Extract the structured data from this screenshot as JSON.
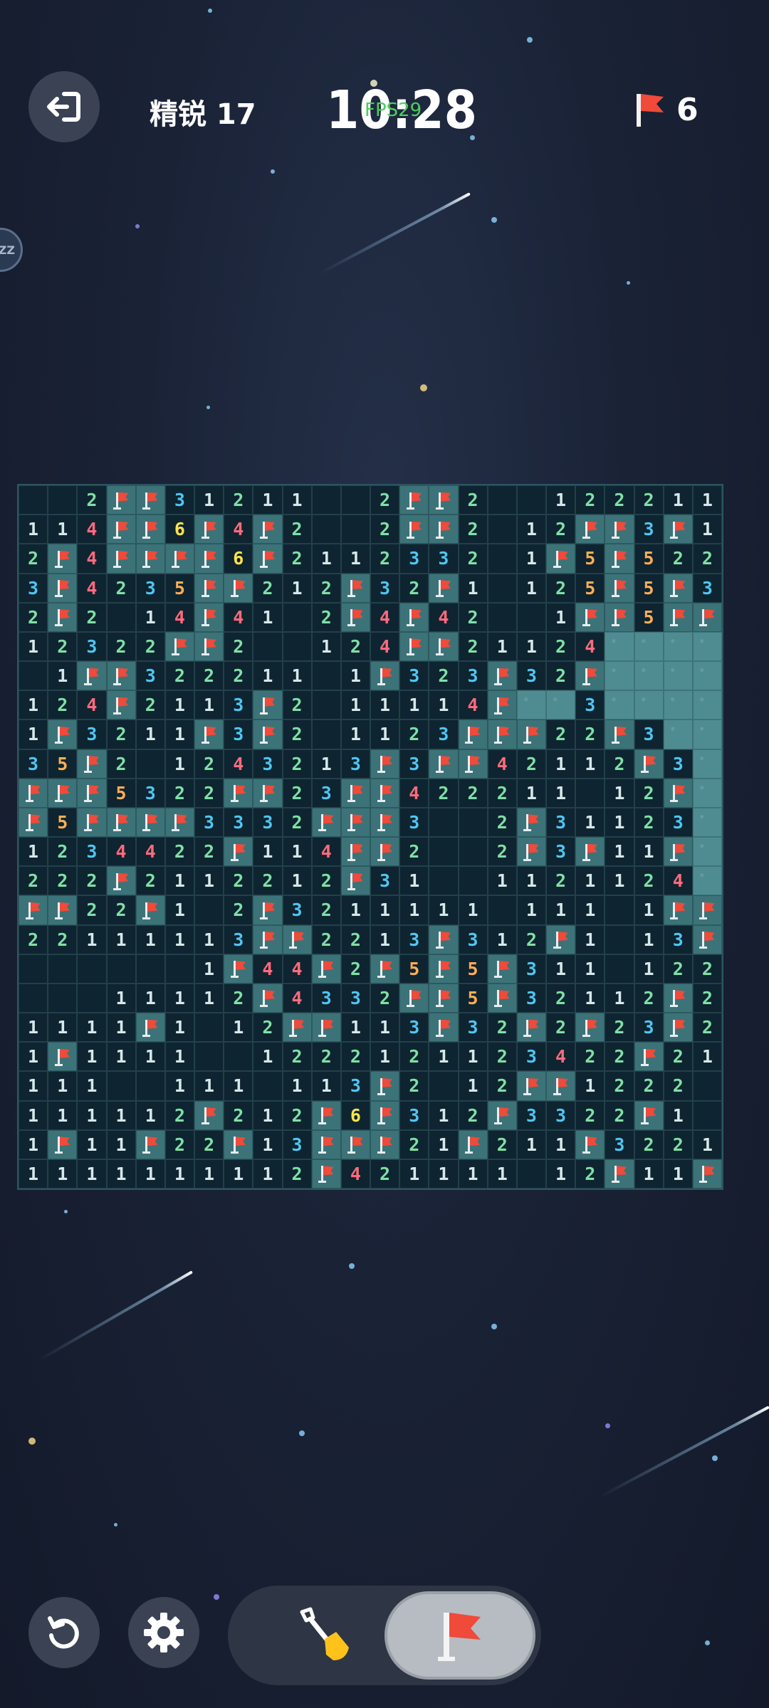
{
  "header": {
    "difficulty_label": "精锐 17",
    "timer": "10:28",
    "fps_overlay": "FPS29",
    "flag_count": "6",
    "side_badge": "ZZ"
  },
  "icons": {
    "exit": "exit-arrow-icon",
    "flag": "red-flag-icon",
    "restart": "restart-icon",
    "settings": "gear-icon",
    "dig": "shovel-icon"
  },
  "colors": {
    "n1": "#d6e8ea",
    "n2": "#7fe0a6",
    "n3": "#4fc6f2",
    "n4": "#ff6a7d",
    "n5": "#ffae55",
    "n6": "#ffe44a",
    "flag": "#ef4a3a",
    "hidden_cell": "#4f8c92",
    "open_cell": "#0e2430"
  },
  "board": {
    "rows": 24,
    "cols": 24,
    "legend": "0=empty revealed, 1-8=number, F=flagged, H=hidden",
    "grid": [
      "0 0 2 F F 3 1 2 1 1 0 0 2 F F 2 0 0 1 2 2 2 1 1",
      "1 1 4 F F 6 F 4 F 2 0 0 2 F F 2 0 1 2 F F 3 F 1",
      "2 F 4 F F F F 6 F 2 1 1 2 3 3 2 0 1 F 5 F 5 2 2",
      "3 F 4 2 3 5 F F 2 1 2 F 3 2 F 1 0 1 2 5 F 5 F 3",
      "2 F 2 0 1 4 F 4 1 0 2 F 4 F 4 2 0 0 1 F F 5 F F",
      "1 2 3 2 2 F F 2 0 0 1 2 4 F F 2 1 1 2 4 H H H H",
      "0 1 F F 3 2 2 2 1 1 0 1 F 3 2 3 F 3 2 F H H H H",
      "1 2 4 F 2 1 1 3 F 2 0 1 1 1 1 4 F H H 3 H H H H",
      "1 F 3 2 1 1 F 3 F 2 0 1 1 2 3 F F F 2 2 F 3 H H",
      "3 5 F 2 0 1 2 4 3 2 1 3 F 3 F F 4 2 1 1 2 F 3 H",
      "F F F 5 3 2 2 F F 2 3 F F 4 2 2 2 1 1 0 1 2 F H",
      "F 5 F F F F 3 3 3 2 F F F 3 0 0 2 F 3 1 1 2 3 H",
      "1 2 3 4 4 2 2 F 1 1 4 F F 2 0 0 2 F 3 F 1 1 F H",
      "2 2 2 F 2 1 1 2 2 1 2 F 3 1 0 0 1 1 2 1 1 2 4 H",
      "F F 2 2 F 1 0 2 F 3 2 1 1 1 1 1 0 1 1 1 0 1 F F",
      "2 2 1 1 1 1 1 3 F F 2 2 1 3 F 3 1 2 F 1 0 1 3 F",
      "0 0 0 0 0 0 1 F 4 4 F 2 F 5 F 5 F 3 1 1 0 1 2 2",
      "0 0 0 1 1 1 1 2 F 4 3 3 2 F F 5 F 3 2 1 1 2 F 2",
      "1 1 1 1 F 1 0 1 2 F F 1 1 3 F 3 2 F 2 F 2 3 F 2",
      "1 F 1 1 1 1 0 0 1 2 2 2 1 2 1 1 2 3 4 2 2 F 2 1",
      "1 1 1 0 0 1 1 1 0 1 1 3 F 2 0 1 2 F F 1 2 2 2 0",
      "1 1 1 1 1 2 F 2 1 2 F 6 F 3 1 2 F 3 3 2 2 F 1 0",
      "1 F 1 1 F 2 2 F 1 3 F F F 2 1 F 2 1 1 F 3 2 2 1",
      "1 1 1 1 1 1 1 1 1 2 F 4 2 1 1 1 1 0 1 2 F 1 1 F"
    ]
  },
  "toolbar": {
    "active_mode": "flag"
  }
}
